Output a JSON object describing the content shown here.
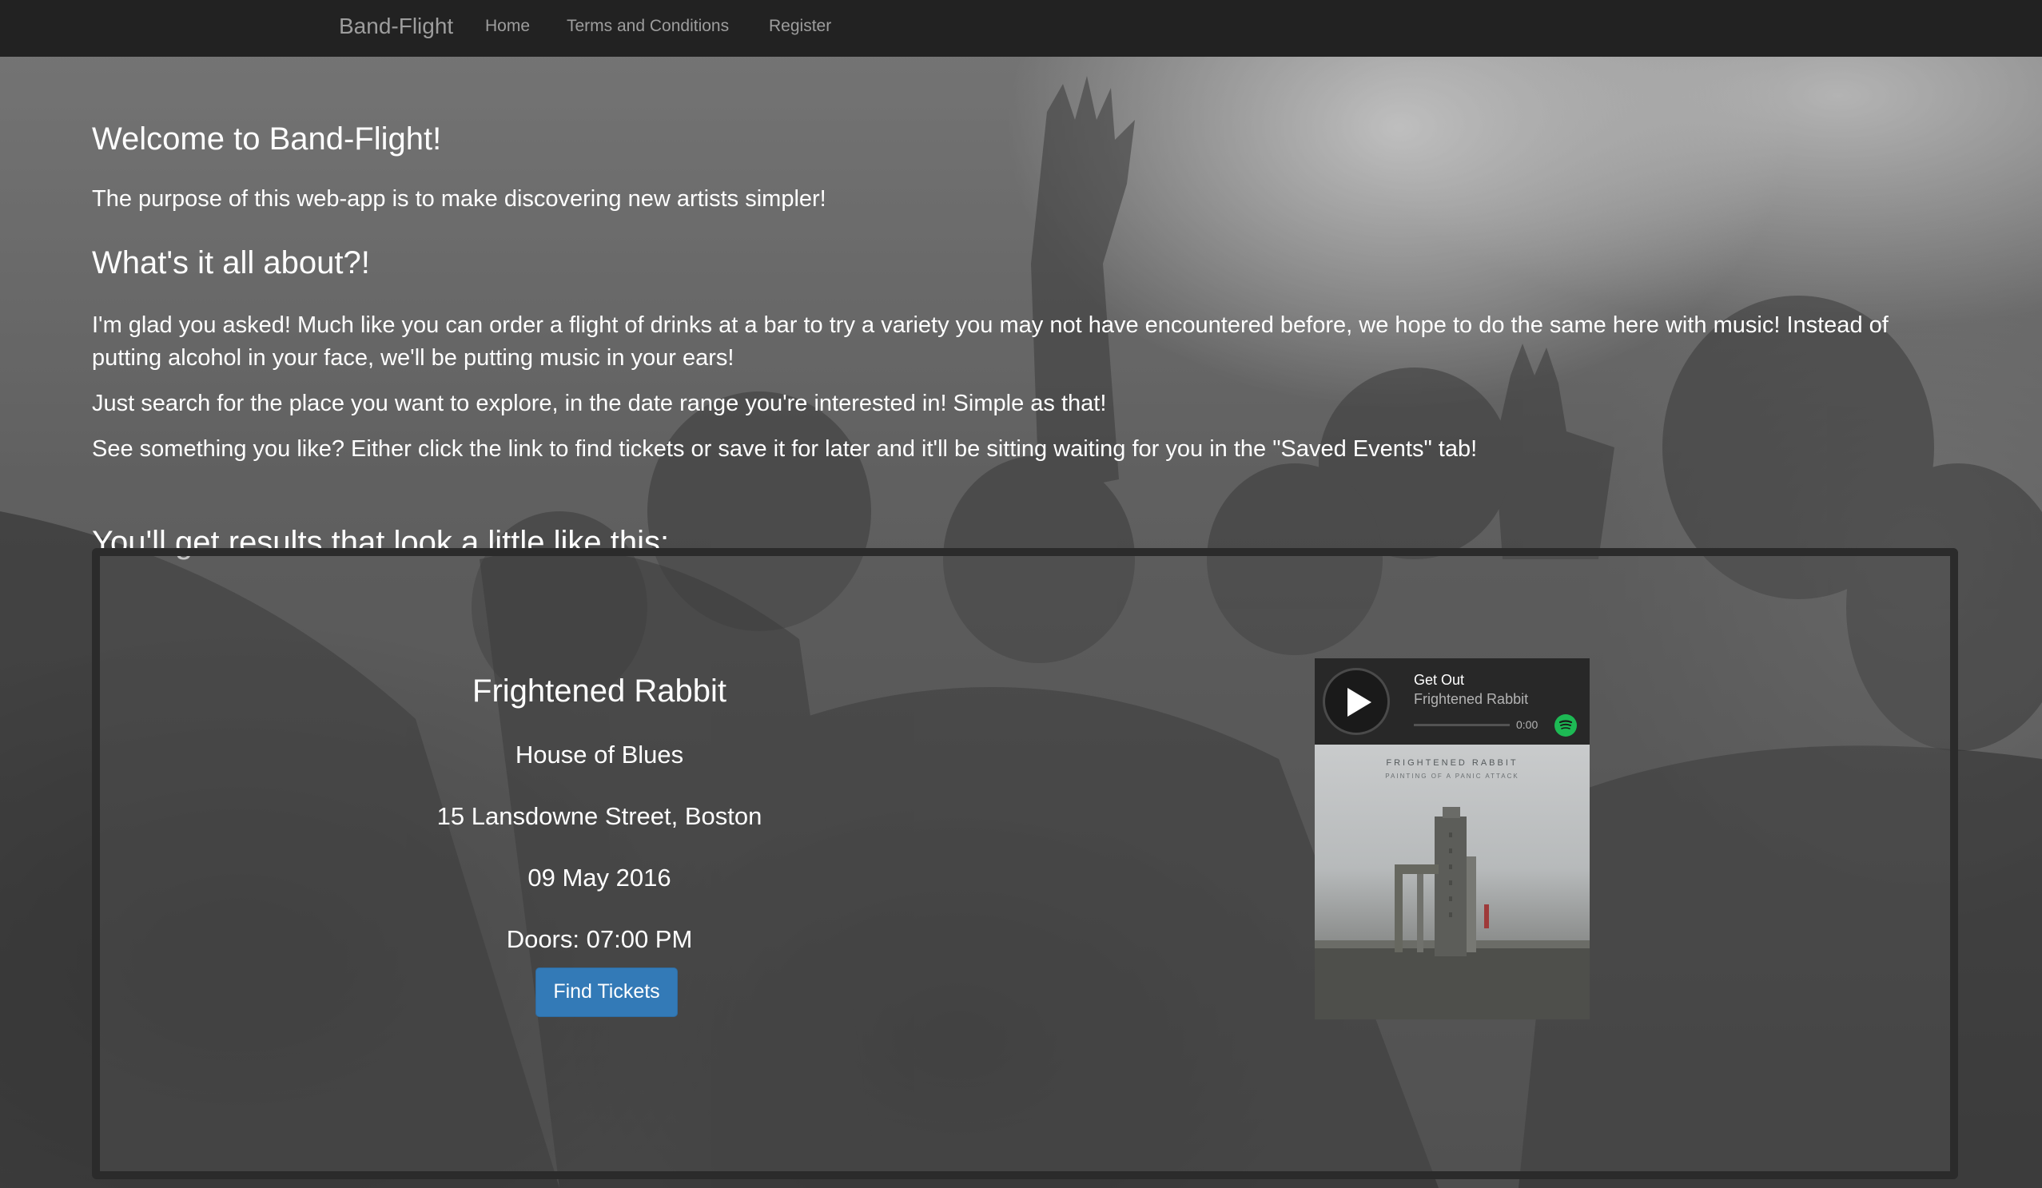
{
  "navbar": {
    "brand": "Band-Flight",
    "links": [
      "Home",
      "Terms and Conditions",
      "Register"
    ]
  },
  "intro": {
    "welcome_heading": "Welcome to Band-Flight!",
    "purpose_text": "The purpose of this web-app is to make discovering new artists simpler!",
    "about_heading": "What's it all about?!",
    "glad_text": "I'm glad you asked! Much like you can order a flight of drinks at a bar to try a variety you may not have encountered before, we hope to do the same here with music! Instead of putting alcohol in your face, we'll be putting music in your ears!",
    "search_text": "Just search for the place you want to explore, in the date range you're interested in! Simple as that!",
    "save_text": "See something you like? Either click the link to find tickets or save it for later and it'll be sitting waiting for you in the \"Saved Events\" tab!",
    "results_heading": "You'll get results that look a little like this:"
  },
  "example_event": {
    "artist": "Frightened Rabbit",
    "venue": "House of Blues",
    "address": "15 Lansdowne Street, Boston",
    "date": "09 May 2016",
    "doors": "Doors: 07:00 PM",
    "button_label": "Find Tickets"
  },
  "player": {
    "track_title": "Get Out",
    "track_artist": "Frightened Rabbit",
    "time": "0:00",
    "progress": 0,
    "album_band_name": "FRIGHTENED RABBIT",
    "album_title": "PAINTING OF A PANIC ATTACK",
    "play_icon": "play-icon",
    "logo_icon": "spotify-logo-icon"
  },
  "colors": {
    "navbar_bg": "#222222",
    "nav_text": "#9d9d9d",
    "button_bg": "#337ab7",
    "spotify_green": "#1db954"
  }
}
